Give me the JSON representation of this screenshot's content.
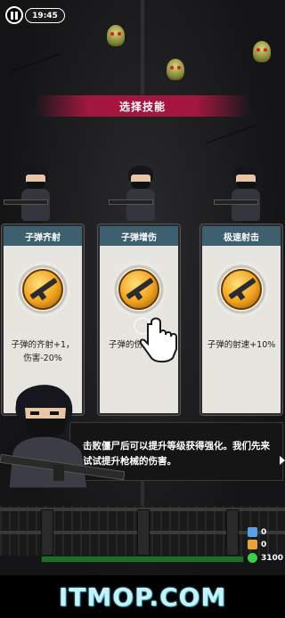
{
  "hud": {
    "time": "19:45"
  },
  "banner": {
    "title": "选择技能"
  },
  "cards": [
    {
      "title": "子弹齐射",
      "description": "子弹的齐射+1，伤害-20%",
      "icon": "rifle-icon"
    },
    {
      "title": "子弹增伤",
      "description": "子弹的伤",
      "icon": "rifle-icon"
    },
    {
      "title": "极速射击",
      "description": "子弹的射速+10%",
      "icon": "rifle-icon"
    }
  ],
  "dialog": {
    "text": "击败僵尸后可以提升等级获得强化。我们先来试试提升枪械的伤害。"
  },
  "stats": {
    "shield": "0",
    "armor": "0",
    "health": "3100"
  },
  "watermark": "ITMOP.COM",
  "colors": {
    "banner": "#a3163f",
    "card_header": "#3e5f6e",
    "health_bar": "#1f6b2a"
  }
}
